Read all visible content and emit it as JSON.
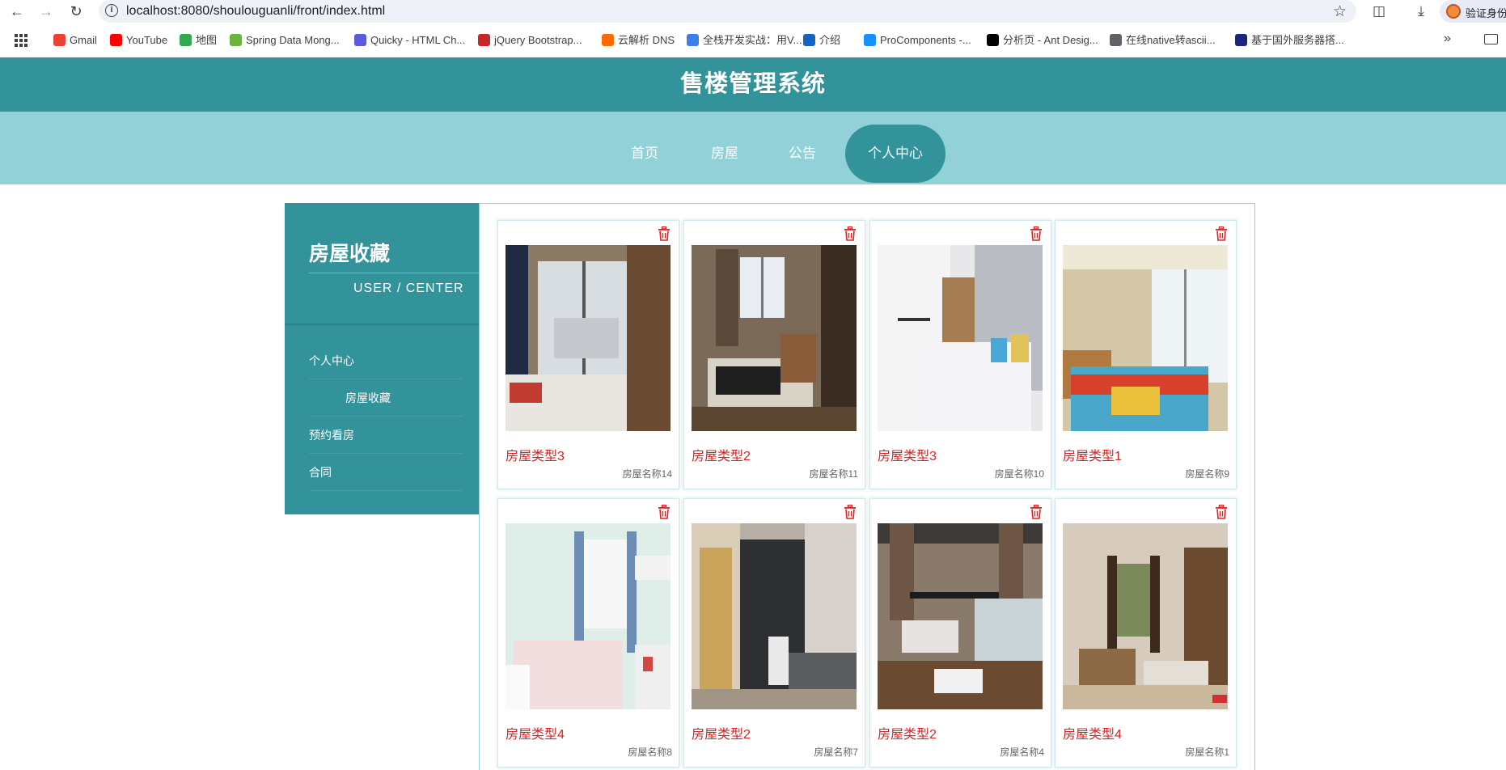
{
  "browser": {
    "url": "localhost:8080/shoulouguanli/front/index.html",
    "profile_label": "验证身份",
    "bookmarks": [
      {
        "label": "Gmail",
        "icon": "gmail-icon",
        "color": "#ea4335"
      },
      {
        "label": "YouTube",
        "icon": "youtube-icon",
        "color": "#ff0000"
      },
      {
        "label": "地图",
        "icon": "maps-pin-icon",
        "color": "#34a853"
      },
      {
        "label": "Spring Data Mong...",
        "icon": "spring-leaf-icon",
        "color": "#6db33f"
      },
      {
        "label": "Quicky - HTML Ch...",
        "icon": "messenger-icon",
        "color": "#5b5bd6"
      },
      {
        "label": "jQuery Bootstrap...",
        "icon": "jquery-icon",
        "color": "#c62828"
      },
      {
        "label": "云解析 DNS",
        "icon": "aliyun-icon",
        "color": "#ff6a00"
      },
      {
        "label": "全栈开发实战：用V...",
        "icon": "m-icon",
        "color": "#3d7eea"
      },
      {
        "label": "介绍",
        "icon": "globe-half-icon",
        "color": "#1565c0"
      },
      {
        "label": "ProComponents -...",
        "icon": "procomponents-icon",
        "color": "#1890ff"
      },
      {
        "label": "分析页 - Ant Desig...",
        "icon": "pro-icon",
        "color": "#000000"
      },
      {
        "label": "在线native转ascii...",
        "icon": "globe-icon",
        "color": "#5f6368"
      },
      {
        "label": "基于国外服务器搭...",
        "icon": "bookmark-logo-icon",
        "color": "#1a237e"
      }
    ]
  },
  "site": {
    "title": "售楼管理系统",
    "nav": [
      {
        "label": "首页",
        "active": false
      },
      {
        "label": "房屋",
        "active": false
      },
      {
        "label": "公告",
        "active": false
      },
      {
        "label": "个人中心",
        "active": true
      }
    ]
  },
  "sidebar": {
    "title": "房屋收藏",
    "subtitle": "USER / CENTER",
    "menu": [
      {
        "label": "个人中心",
        "child": false
      },
      {
        "label": "房屋收藏",
        "child": true
      },
      {
        "label": "预约看房",
        "child": false
      },
      {
        "label": "合同",
        "child": false
      }
    ]
  },
  "favorites": [
    {
      "type": "房屋类型3",
      "name": "房屋名称14",
      "image": "room-balcony-door-photo"
    },
    {
      "type": "房屋类型2",
      "name": "房屋名称11",
      "image": "room-desk-window-photo"
    },
    {
      "type": "房屋类型3",
      "name": "房屋名称10",
      "image": "room-white-wardrobe-photo"
    },
    {
      "type": "房屋类型1",
      "name": "房屋名称9",
      "image": "room-colorful-bedding-photo"
    },
    {
      "type": "房屋类型4",
      "name": "房屋名称8",
      "image": "room-white-bed-photo"
    },
    {
      "type": "房屋类型2",
      "name": "房屋名称7",
      "image": "room-loft-stairs-photo"
    },
    {
      "type": "房屋类型2",
      "name": "房屋名称4",
      "image": "room-loft-bed-photo"
    },
    {
      "type": "房屋类型4",
      "name": "房屋名称1",
      "image": "room-wood-floor-photo"
    }
  ],
  "colors": {
    "header": "#33939a",
    "nav": "#92d1d8",
    "accent_red": "#e02020"
  }
}
